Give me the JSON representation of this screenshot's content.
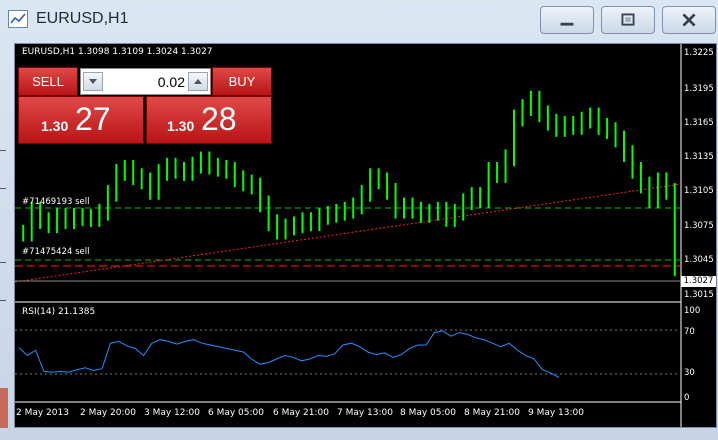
{
  "window": {
    "title": "EURUSD,H1",
    "minimize_icon": "minimize-icon",
    "maximize_icon": "maximize-icon",
    "close_icon": "close-icon"
  },
  "chart": {
    "header": "EURUSD,H1  1.3098 1.3109 1.3024 1.3027",
    "price_axis": [
      "1.3225",
      "1.3195",
      "1.3165",
      "1.3135",
      "1.3105",
      "1.3075",
      "1.3045",
      "1.3015"
    ],
    "current_price_tag": "1.3027",
    "time_axis": [
      "2 May 2013",
      "2 May 20:00",
      "3 May 12:00",
      "6 May 05:00",
      "6 May 21:00",
      "7 May 13:00",
      "8 May 05:00",
      "8 May 21:00",
      "9 May 13:00"
    ],
    "order_labels": [
      "#71469193 sell",
      "#71475424 sell"
    ],
    "colors": {
      "bull_bar": "#00ff00",
      "bg": "#000000",
      "rsi_line": "#1e90ff",
      "trend_line": "#ff2020",
      "order_line_green": "#00c000"
    }
  },
  "rsi": {
    "label": "RSI(14) 21.1385",
    "scale": [
      "100",
      "70",
      "30",
      "0"
    ]
  },
  "trade_panel": {
    "sell_label": "SELL",
    "buy_label": "BUY",
    "lot_value": "0.02",
    "sell_prefix": "1.30",
    "sell_main": "27",
    "buy_prefix": "1.30",
    "buy_main": "28"
  },
  "chart_data": {
    "type": "bar",
    "title": "EURUSD,H1",
    "ylim": [
      1.3,
      1.3235
    ],
    "price_series": [
      1.306,
      1.3082,
      1.3072,
      1.3068,
      1.3076,
      1.3072,
      1.3076,
      1.3075,
      1.3074,
      1.308,
      1.3098,
      1.3118,
      1.3122,
      1.3114,
      1.311,
      1.31,
      1.3118,
      1.3124,
      1.312,
      1.3118,
      1.3125,
      1.313,
      1.3124,
      1.3122,
      1.312,
      1.3112,
      1.3108,
      1.3105,
      1.3088,
      1.307,
      1.3062,
      1.3066,
      1.3068,
      1.3072,
      1.307,
      1.3076,
      1.3078,
      1.308,
      1.3082,
      1.3086,
      1.3098,
      1.3114,
      1.311,
      1.31,
      1.3082,
      1.3086,
      1.3082,
      1.3078,
      1.308,
      1.3082,
      1.3074,
      1.308,
      1.309,
      1.3096,
      1.3092,
      1.312,
      1.3116,
      1.3132,
      1.317,
      1.318,
      1.3188,
      1.3174,
      1.3166,
      1.316,
      1.3164,
      1.3162,
      1.3168,
      1.3172,
      1.3162,
      1.3158,
      1.315,
      1.3136,
      1.312,
      1.3106,
      1.3092,
      1.311,
      1.31,
      1.3027
    ],
    "rsi_ylim": [
      0,
      100
    ],
    "rsi_series": [
      55,
      46,
      52,
      28,
      27,
      28,
      27,
      30,
      32,
      29,
      31,
      60,
      62,
      57,
      54,
      46,
      60,
      64,
      62,
      59,
      62,
      64,
      60,
      58,
      56,
      54,
      52,
      50,
      42,
      36,
      38,
      42,
      46,
      44,
      40,
      42,
      46,
      45,
      48,
      58,
      60,
      56,
      50,
      47,
      49,
      44,
      47,
      54,
      58,
      58,
      72,
      74,
      68,
      72,
      70,
      66,
      64,
      60,
      56,
      60,
      52,
      46,
      42,
      30,
      26,
      21
    ]
  }
}
